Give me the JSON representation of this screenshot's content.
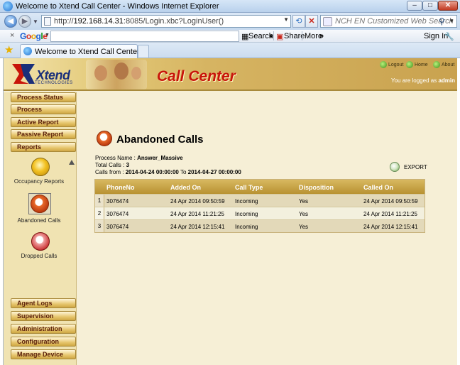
{
  "browser": {
    "window_title": "Welcome to Xtend Call Center - Windows Internet Explorer",
    "url_prefix": "http://",
    "url_host": "192.168.14.31",
    "url_rest": ":8085/Login.xbc?LoginUser()",
    "search_placeholder": "NCH EN Customized Web Search",
    "tab_title": "Welcome to Xtend Call Center",
    "google_toolbar": {
      "search_label": "Search",
      "share_label": "Share",
      "more_label": "More",
      "signin_label": "Sign In"
    }
  },
  "header": {
    "logo_text": "Xtend",
    "logo_sub": "TECHNOLOGIES",
    "app_title": "Call Center",
    "logout_label": "Logout",
    "home_label": "Home",
    "about_label": "About",
    "logged_prefix": "You are logged as",
    "logged_user": "admin"
  },
  "nav": {
    "top_buttons": [
      "Process Status",
      "Process",
      "Active Report",
      "Passive Report",
      "Reports"
    ],
    "report_items": [
      "Occupancy Reports",
      "Abandoned Calls",
      "Dropped Calls"
    ],
    "bottom_buttons": [
      "Agent Logs",
      "Supervision",
      "Administration",
      "Configuration",
      "Manage Device"
    ]
  },
  "main": {
    "title": "Abandoned Calls",
    "process_label": "Process Name :",
    "process_value": "Answer_Massive",
    "total_label": "Total Calls :",
    "total_value": "3",
    "calls_from_label": "Calls from :",
    "date_from": "2014-04-24 00:00:00",
    "to_label": "To",
    "date_to": "2014-04-27 00:00:00",
    "export_label": "EXPORT"
  },
  "table": {
    "columns": [
      "PhoneNo",
      "Added On",
      "Call Type",
      "Disposition",
      "Called On"
    ],
    "rows": [
      {
        "idx": "1",
        "phone": "3076474",
        "added": "24 Apr 2014 09:50:59",
        "type": "Incoming",
        "disposition": "Yes",
        "called": "24 Apr 2014 09:50:59"
      },
      {
        "idx": "2",
        "phone": "3076474",
        "added": "24 Apr 2014 11:21:25",
        "type": "Incoming",
        "disposition": "Yes",
        "called": "24 Apr 2014 11:21:25"
      },
      {
        "idx": "3",
        "phone": "3076474",
        "added": "24 Apr 2014 12:15:41",
        "type": "Incoming",
        "disposition": "Yes",
        "called": "24 Apr 2014 12:15:41"
      }
    ]
  }
}
